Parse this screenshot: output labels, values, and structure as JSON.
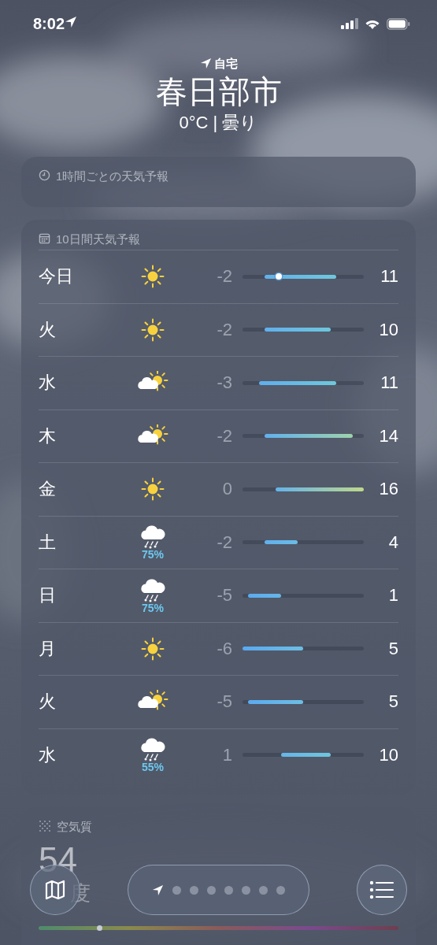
{
  "status_bar": {
    "time": "8:02"
  },
  "header": {
    "place_label": "自宅",
    "city": "春日部市",
    "summary": "0°C | 曇り"
  },
  "hourly": {
    "title": "1時間ごとの天気予報"
  },
  "forecast": {
    "title": "10日間天気予報",
    "days": [
      {
        "day": "今日",
        "kind": "sun",
        "low": "-2",
        "high": "11",
        "current": {
          "level": 0.3
        }
      },
      {
        "day": "火",
        "kind": "sun",
        "low": "-2",
        "high": "10"
      },
      {
        "day": "水",
        "kind": "partly_cloudy",
        "low": "-3",
        "high": "11"
      },
      {
        "day": "木",
        "kind": "partly_cloudy",
        "low": "-2",
        "high": "14"
      },
      {
        "day": "金",
        "kind": "sun",
        "low": "0",
        "high": "16"
      },
      {
        "day": "土",
        "kind": "snow",
        "precip": "75%",
        "low": "-2",
        "high": "4"
      },
      {
        "day": "日",
        "kind": "snow",
        "precip": "75%",
        "low": "-5",
        "high": "1"
      },
      {
        "day": "月",
        "kind": "sun",
        "low": "-6",
        "high": "5"
      },
      {
        "day": "火",
        "kind": "partly_cloudy",
        "low": "-5",
        "high": "5"
      },
      {
        "day": "水",
        "kind": "snow",
        "precip": "55%",
        "low": "1",
        "high": "10"
      }
    ]
  },
  "air_quality": {
    "title": "空気質",
    "value": "54",
    "label": "度",
    "level": 0.17
  },
  "pager": {
    "pages": [
      {
        "kind": "location",
        "selected": true
      },
      {
        "kind": "dot",
        "selected": false
      },
      {
        "kind": "dot",
        "selected": false
      },
      {
        "kind": "dot",
        "selected": false
      },
      {
        "kind": "dot",
        "selected": false
      },
      {
        "kind": "dot",
        "selected": false
      },
      {
        "kind": "dot",
        "selected": false
      },
      {
        "kind": "dot",
        "selected": false
      }
    ]
  }
}
